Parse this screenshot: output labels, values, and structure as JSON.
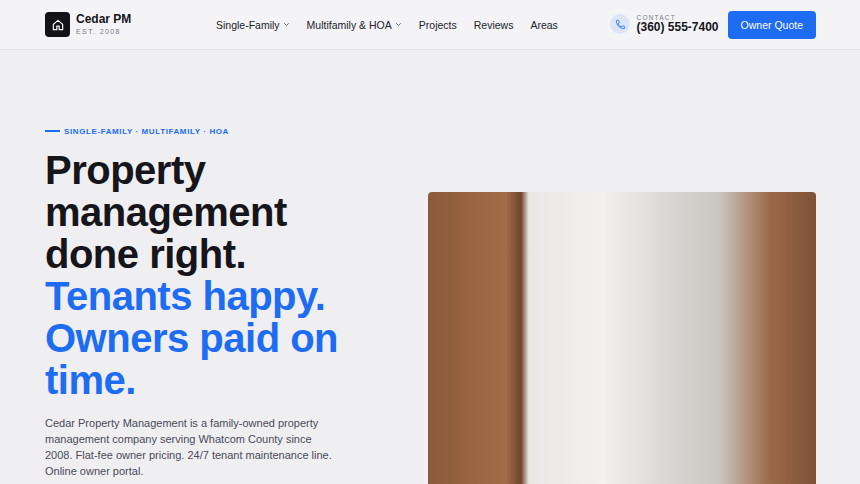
{
  "brand": {
    "name": "Cedar PM",
    "tagline": "EST. 2008"
  },
  "nav": [
    {
      "label": "Single-Family",
      "has_menu": true
    },
    {
      "label": "Multifamily & HOA",
      "has_menu": true
    },
    {
      "label": "Projects",
      "has_menu": false
    },
    {
      "label": "Reviews",
      "has_menu": false
    },
    {
      "label": "Areas",
      "has_menu": false
    }
  ],
  "contact": {
    "label": "CONTACT",
    "phone": "(360) 555-7400"
  },
  "cta": {
    "label": "Owner Quote"
  },
  "hero": {
    "eyebrow": "SINGLE-FAMILY · MULTIFAMILY · HOA",
    "headline": "Property management done right.",
    "headline_accent": "Tenants happy. Owners paid on time.",
    "body": "Cedar Property Management is a family-owned property management company serving Whatcom County since 2008. Flat-fee owner pricing. 24/7 tenant maintenance line. Online owner portal."
  }
}
